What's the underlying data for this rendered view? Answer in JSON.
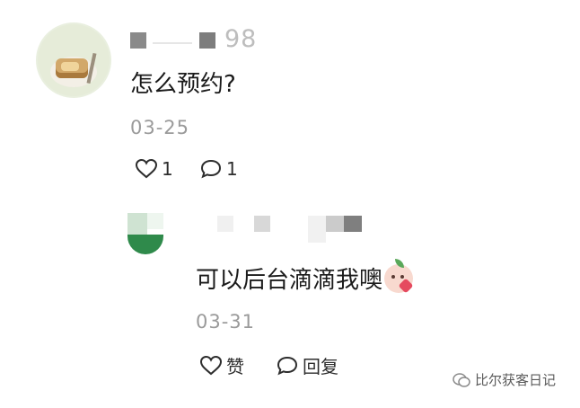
{
  "comment": {
    "username_suffix": "98",
    "text": "怎么预约?",
    "date": "03-25",
    "likes": "1",
    "replies": "1"
  },
  "reply": {
    "text": "可以后台滴滴我噢",
    "date": "03-31",
    "like_label": "赞",
    "reply_label": "回复"
  },
  "watermark": {
    "text": "比尔获客日记"
  }
}
